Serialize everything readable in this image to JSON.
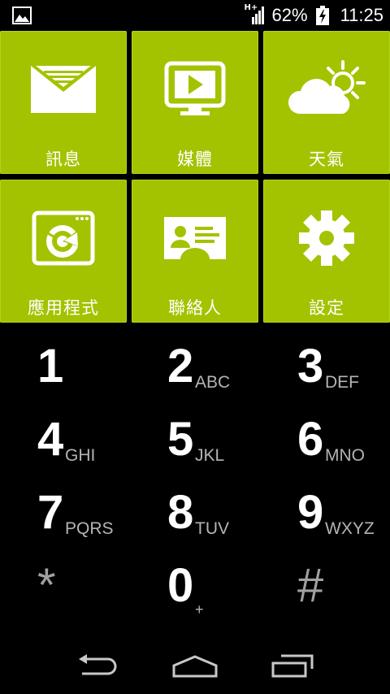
{
  "status_bar": {
    "network_type": "H+",
    "battery_percent": "62%",
    "time": "11:25",
    "icons": [
      "image-icon",
      "signal-icon",
      "battery-charging-icon"
    ]
  },
  "tiles": [
    {
      "label": "訊息",
      "icon": "message-icon"
    },
    {
      "label": "媒體",
      "icon": "media-player-icon"
    },
    {
      "label": "天氣",
      "icon": "weather-icon"
    },
    {
      "label": "應用程式",
      "icon": "apps-icon"
    },
    {
      "label": "聯絡人",
      "icon": "contacts-icon"
    },
    {
      "label": "設定",
      "icon": "gear-icon"
    }
  ],
  "dialpad": {
    "keys": [
      {
        "digit": "1",
        "letters": ""
      },
      {
        "digit": "2",
        "letters": "ABC"
      },
      {
        "digit": "3",
        "letters": "DEF"
      },
      {
        "digit": "4",
        "letters": "GHI"
      },
      {
        "digit": "5",
        "letters": "JKL"
      },
      {
        "digit": "6",
        "letters": "MNO"
      },
      {
        "digit": "7",
        "letters": "PQRS"
      },
      {
        "digit": "8",
        "letters": "TUV"
      },
      {
        "digit": "9",
        "letters": "WXYZ"
      },
      {
        "digit": "*",
        "letters": ""
      },
      {
        "digit": "0",
        "letters": "+"
      },
      {
        "digit": "#",
        "letters": ""
      }
    ]
  },
  "navbar": {
    "icons": [
      "back-icon",
      "home-icon",
      "recent-apps-icon"
    ]
  },
  "colors": {
    "tile_green": "#a3c300",
    "background": "#000000",
    "secondary_text": "#b4b4b4"
  }
}
